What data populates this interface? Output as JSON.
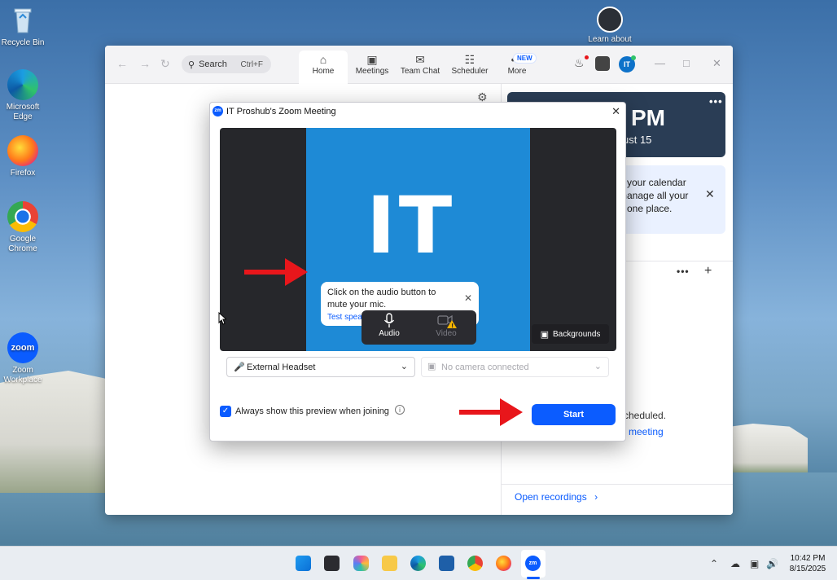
{
  "desktop": {
    "icons": [
      {
        "label": "Recycle Bin"
      },
      {
        "label": "Microsoft Edge"
      },
      {
        "label": "Firefox"
      },
      {
        "label": "Google Chrome"
      },
      {
        "label": "Zoom Workplace"
      },
      {
        "label": "Learn about"
      }
    ]
  },
  "zoom": {
    "search": {
      "placeholder": "Search",
      "shortcut": "Ctrl+F"
    },
    "tabs": [
      {
        "label": "Home"
      },
      {
        "label": "Meetings"
      },
      {
        "label": "Team Chat"
      },
      {
        "label": "Scheduler"
      },
      {
        "label": "More"
      }
    ],
    "new_badge": "NEW",
    "avatar_initials": "IT",
    "clock": {
      "time": "PM",
      "date": "ust 15"
    },
    "calendar_prompt": {
      "line1": "d your calendar",
      "line2": "manage all your",
      "line3": "n one place."
    },
    "meetings": {
      "empty_text": "cheduled.",
      "link_text": "meeting"
    },
    "open_recordings": "Open recordings"
  },
  "modal": {
    "title": "IT Proshub's Zoom Meeting",
    "logo_text": "zm",
    "video_text": "IT",
    "tooltip": {
      "text": "Click on the audio button to mute your mic.",
      "link": "Test speaker and microphone"
    },
    "audio_label": "Audio",
    "video_label": "Video",
    "backgrounds_label": "Backgrounds",
    "mic_select": "External Headset",
    "camera_select": "No camera connected",
    "checkbox_label": "Always show this preview when joining",
    "checkbox_checked": true,
    "start_label": "Start"
  },
  "taskbar": {
    "time": "10:42 PM",
    "date": "8/15/2025"
  },
  "colors": {
    "zoom_blue": "#0b5cff",
    "arrow_red": "#e8161b",
    "video_blue": "#1e8ad6"
  }
}
